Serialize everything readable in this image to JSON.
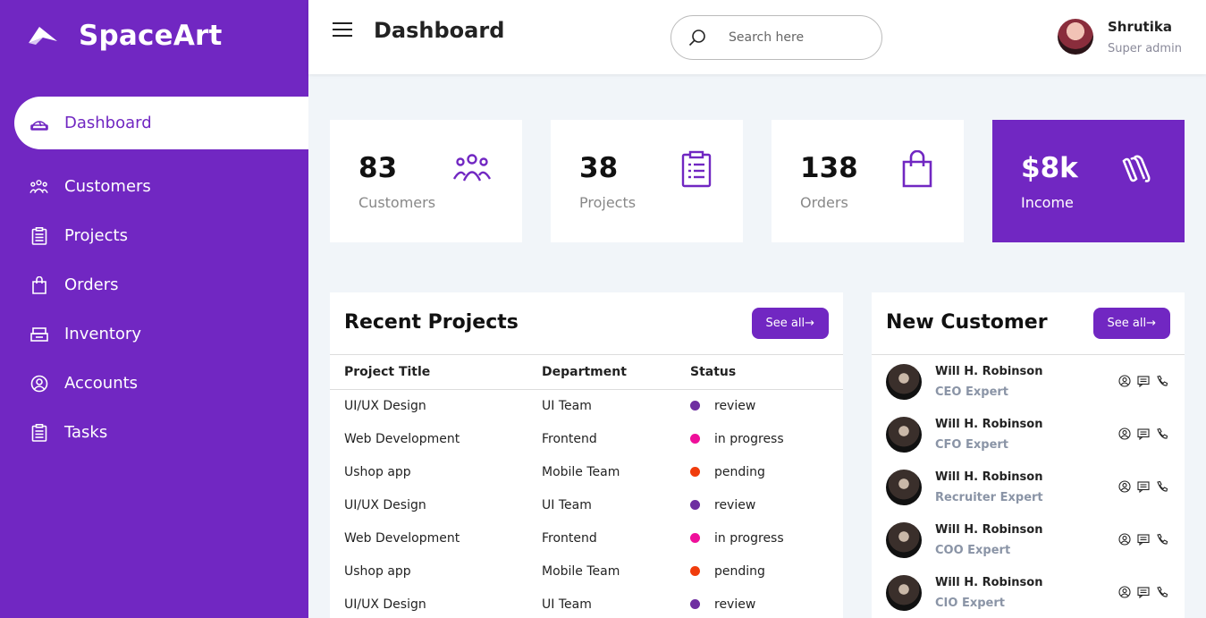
{
  "brand": {
    "name": "SpaceArt",
    "logo_icon": "paper-plane-icon"
  },
  "sidebar": {
    "items": [
      {
        "label": "Dashboard",
        "icon": "dashboard-icon",
        "active": true
      },
      {
        "label": "Customers",
        "icon": "people-icon"
      },
      {
        "label": "Projects",
        "icon": "clipboard-icon"
      },
      {
        "label": "Orders",
        "icon": "shopping-bag-icon"
      },
      {
        "label": "Inventory",
        "icon": "inventory-icon"
      },
      {
        "label": "Accounts",
        "icon": "user-circle-icon"
      },
      {
        "label": "Tasks",
        "icon": "clipboard-icon"
      }
    ]
  },
  "header": {
    "title": "Dashboard",
    "search_placeholder": "Search here",
    "user": {
      "name": "Shrutika",
      "role": "Super admin"
    }
  },
  "stats": [
    {
      "value": "83",
      "label": "Customers",
      "icon": "people-icon"
    },
    {
      "value": "38",
      "label": "Projects",
      "icon": "clipboard-icon"
    },
    {
      "value": "138",
      "label": "Orders",
      "icon": "shopping-bag-icon"
    },
    {
      "value": "$8k",
      "label": "Income",
      "icon": "money-icon"
    }
  ],
  "recent_projects": {
    "title": "Recent Projects",
    "see_all": "See all→",
    "columns": [
      "Project Title",
      "Department",
      "Status"
    ],
    "rows": [
      {
        "title": "UI/UX Design",
        "department": "UI Team",
        "status": "review",
        "color": "#6e2ea1"
      },
      {
        "title": "Web Development",
        "department": "Frontend",
        "status": "in progress",
        "color": "#ef0f9a"
      },
      {
        "title": "Ushop app",
        "department": "Mobile Team",
        "status": "pending",
        "color": "#f03c0c"
      },
      {
        "title": "UI/UX Design",
        "department": "UI Team",
        "status": "review",
        "color": "#6e2ea1"
      },
      {
        "title": "Web Development",
        "department": "Frontend",
        "status": "in progress",
        "color": "#ef0f9a"
      },
      {
        "title": "Ushop app",
        "department": "Mobile Team",
        "status": "pending",
        "color": "#f03c0c"
      },
      {
        "title": "UI/UX Design",
        "department": "UI Team",
        "status": "review",
        "color": "#6e2ea1"
      }
    ]
  },
  "new_customer": {
    "title": "New Customer",
    "see_all": "See all→",
    "customers": [
      {
        "name": "Will H. Robinson",
        "role": "CEO Expert"
      },
      {
        "name": "Will H. Robinson",
        "role": "CFO Expert"
      },
      {
        "name": "Will H. Robinson",
        "role": "Recruiter Expert"
      },
      {
        "name": "Will H. Robinson",
        "role": "COO Expert"
      },
      {
        "name": "Will H. Robinson",
        "role": "CIO Expert"
      }
    ]
  },
  "colors": {
    "accent": "#7127c2",
    "background": "#f1f5f9"
  }
}
